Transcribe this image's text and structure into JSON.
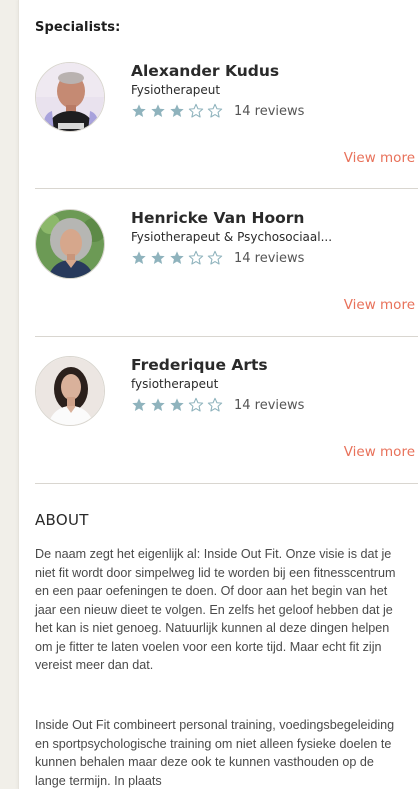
{
  "section_title": "Specialists:",
  "specialists": [
    {
      "name": "Alexander Kudus",
      "role": "Fysiotherapeut",
      "rating": 3,
      "max_rating": 5,
      "reviews": "14 reviews",
      "view_more": "View more"
    },
    {
      "name": "Henricke Van Hoorn",
      "role": "Fysiotherapeut & Psychosociaal...",
      "rating": 3,
      "max_rating": 5,
      "reviews": "14 reviews",
      "view_more": "View more"
    },
    {
      "name": "Frederique Arts",
      "role": "fysiotherapeut",
      "rating": 3,
      "max_rating": 5,
      "reviews": "14 reviews",
      "view_more": "View more"
    }
  ],
  "about": {
    "title": "ABOUT",
    "paragraphs": [
      "De naam zegt het eigenlijk al: Inside Out Fit. Onze visie is dat je niet fit wordt door simpelweg lid te worden bij een fitnesscentrum en een paar oefeningen te doen. Of door aan het begin van het jaar een nieuw dieet te volgen. En zelfs het geloof hebben dat je het kan is niet genoeg. Natuurlijk kunnen al deze dingen helpen om je fitter te laten voelen voor een korte tijd. Maar echt fit zijn vereist meer dan dat.",
      "Inside Out Fit combineert personal training, voedingsbegeleiding en sportpsychologische training om niet alleen fysieke doelen te kunnen behalen maar deze ook te kunnen vasthouden op de lange termijn. In plaats"
    ]
  },
  "colors": {
    "star_filled": "#8fb3bd",
    "star_empty": "#8fb3bd",
    "link": "#e8715a",
    "page_bg": "#f1efe9"
  },
  "icons": [
    "star-filled-icon",
    "star-empty-icon"
  ]
}
